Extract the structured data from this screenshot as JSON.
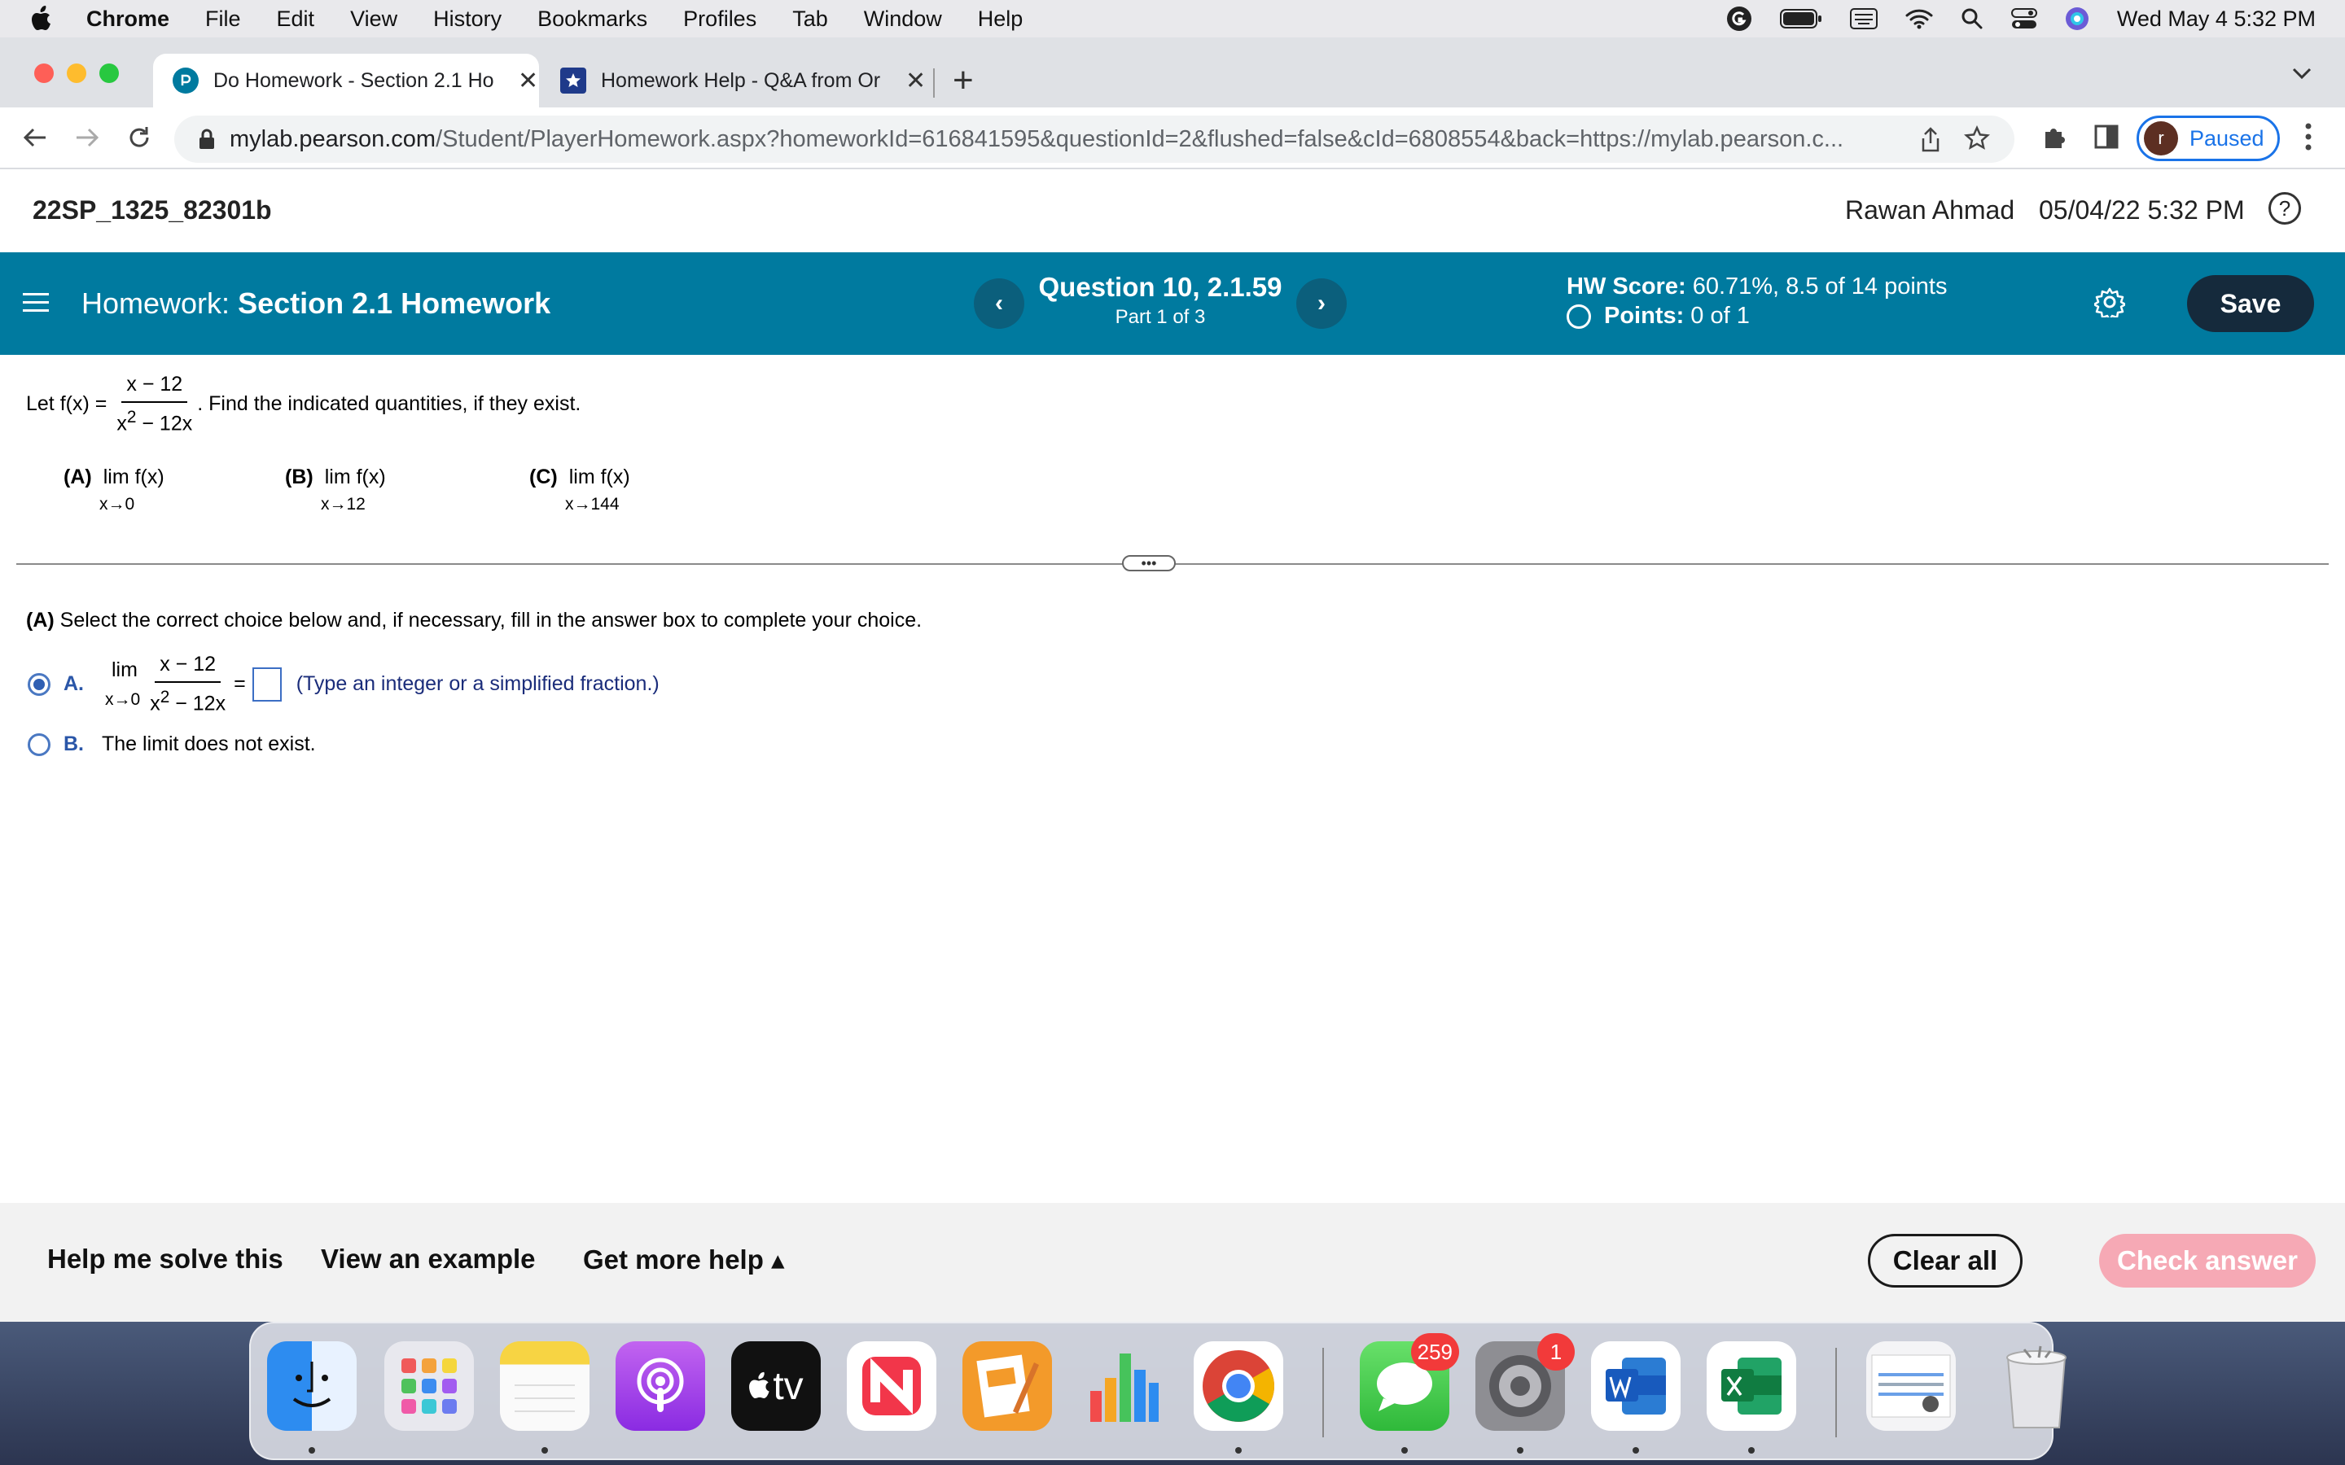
{
  "menubar": {
    "items": [
      "Chrome",
      "File",
      "Edit",
      "View",
      "History",
      "Bookmarks",
      "Profiles",
      "Tab",
      "Window",
      "Help"
    ],
    "clock": "Wed May 4  5:32 PM"
  },
  "tabs": [
    {
      "title": "Do Homework - Section 2.1 Ho",
      "active": true
    },
    {
      "title": "Homework Help - Q&A from Or",
      "active": false
    }
  ],
  "address": {
    "host": "mylab.pearson.com",
    "path": "/Student/PlayerHomework.aspx?homeworkId=616841595&questionId=2&flushed=false&cId=6808554&back=https://mylab.pearson.c..."
  },
  "profile": {
    "initial": "r",
    "status": "Paused"
  },
  "header": {
    "course": "22SP_1325_82301b",
    "user": "Rawan Ahmad",
    "datetime": "05/04/22 5:32 PM",
    "help_glyph": "?"
  },
  "hwbar": {
    "label": "Homework:",
    "name": "Section 2.1 Homework",
    "prev": "‹",
    "next": "›",
    "question": "Question 10, 2.1.59",
    "part": "Part 1 of 3",
    "score_label": "HW Score:",
    "score_value": "60.71%, 8.5 of 14 points",
    "points_label": "Points:",
    "points_value": "0 of 1",
    "save": "Save"
  },
  "question": {
    "let": "Let f(x) =",
    "numerator": "x − 12",
    "den_base": "x",
    "den_exp": "2",
    "den_rest": " − 12x",
    "tail": ". Find the indicated quantities, if they exist.",
    "parts": [
      {
        "label": "(A)",
        "lim": "lim",
        "fn": "f(x)",
        "sub": "x→0"
      },
      {
        "label": "(B)",
        "lim": "lim",
        "fn": "f(x)",
        "sub": "x→12"
      },
      {
        "label": "(C)",
        "lim": "lim",
        "fn": "f(x)",
        "sub": "x→144"
      }
    ],
    "grip": "•••"
  },
  "answer": {
    "instruction_bold": "(A)",
    "instruction": " Select the correct choice below and, if necessary, fill in the answer box to complete your choice.",
    "choiceA": {
      "label": "A.",
      "lim": "lim",
      "sub": "x→0",
      "numerator": "x − 12",
      "den_base": "x",
      "den_exp": "2",
      "den_rest": " − 12x",
      "equals": "=",
      "hint": "(Type an integer or a simplified fraction.)",
      "selected": true
    },
    "choiceB": {
      "label": "B.",
      "text": "The limit does not exist.",
      "selected": false
    }
  },
  "helpbar": {
    "help_solve": "Help me solve this",
    "example": "View an example",
    "more": "Get more help ▴",
    "clear": "Clear all",
    "check": "Check answer"
  },
  "dock": {
    "apps": [
      "finder",
      "launchpad",
      "notes",
      "podcasts",
      "apple-tv",
      "news",
      "pages",
      "numbers",
      "chrome",
      "messages",
      "system-preferences",
      "word",
      "excel",
      "screenshot",
      "trash"
    ],
    "tv_label": "tv",
    "messages_badge": "259",
    "settings_badge": "1"
  },
  "colors": {
    "brand_teal": "#007a9f",
    "save_bg": "#152a3c",
    "check_disabled": "#f6a9b5",
    "link_blue": "#1a73e8"
  }
}
